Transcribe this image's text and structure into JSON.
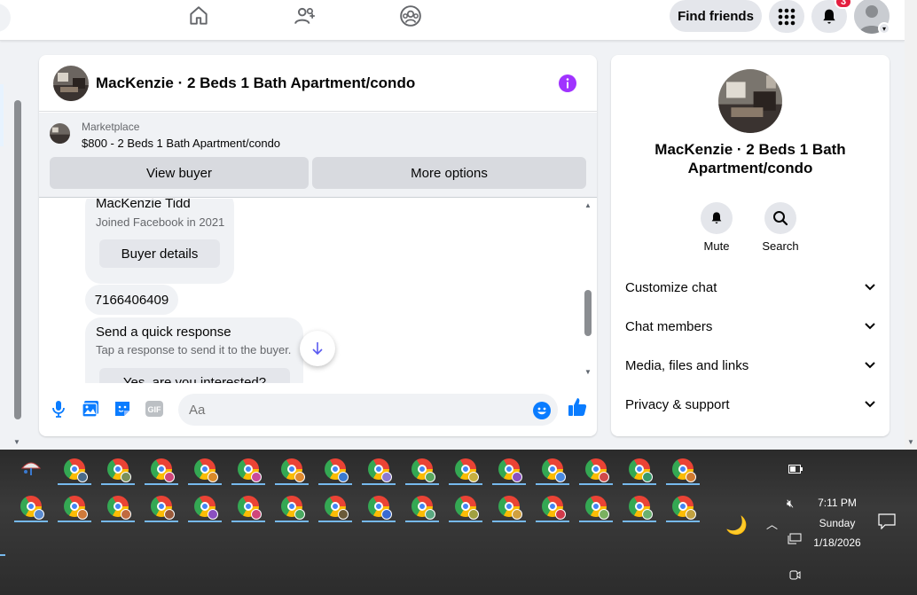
{
  "nav": {
    "find_friends": "Find friends",
    "notification_count": "3"
  },
  "chat": {
    "title": "MacKenzie · 2 Beds 1 Bath Apartment/condo",
    "marketplace_label": "Marketplace",
    "listing": "$800 - 2 Beds 1 Bath Apartment/condo",
    "view_buyer": "View buyer",
    "more_options": "More options",
    "buyer_name": "MacKenzie Tidd",
    "buyer_joined": "Joined Facebook in 2021",
    "buyer_details": "Buyer details",
    "phone_message": "7166406409",
    "quick_title": "Send a quick response",
    "quick_sub": "Tap a response to send it to the buyer.",
    "quick_option": "Yes, are you interested?",
    "composer_placeholder": "Aa"
  },
  "info": {
    "title": "MacKenzie · 2 Beds 1 Bath Apartment/condo",
    "actions": [
      {
        "label": "Mute",
        "icon": "bell-icon"
      },
      {
        "label": "Search",
        "icon": "search-icon"
      }
    ],
    "sections": [
      {
        "label": "Customize chat"
      },
      {
        "label": "Chat members"
      },
      {
        "label": "Media, files and links"
      },
      {
        "label": "Privacy & support"
      }
    ]
  },
  "taskbar": {
    "time": "7:11 PM",
    "day": "Sunday",
    "date": "1/18/2026",
    "profile_colors_row1": [
      "#4a6b8a",
      "#7a8f5a",
      "#d0467a",
      "#d98a2a",
      "#c94a9a",
      "#e08a30",
      "#3a7ad0",
      "#8a7ad0",
      "#5aa860",
      "#c8b040",
      "#8a50c0",
      "#4a8ae0",
      "#d04a4a",
      "#3a9a6a",
      "#d07a30"
    ],
    "profile_colors_row2": [
      "#5a8ad0",
      "#d07a3a",
      "#c06a40",
      "#9a5a3a",
      "#8a50c0",
      "#d0467a",
      "#4aa860",
      "#6a5a3a",
      "#3a6ad0",
      "#5aa880",
      "#a0a040",
      "#d0a040",
      "#d03a4a",
      "#7ab060",
      "#6ab070",
      "#c0a040"
    ]
  },
  "colors": {
    "accent": "#0866ff",
    "info_purple": "#a033ff",
    "messenger_blue": "#0a7cff",
    "badge_red": "#e41e3f"
  }
}
